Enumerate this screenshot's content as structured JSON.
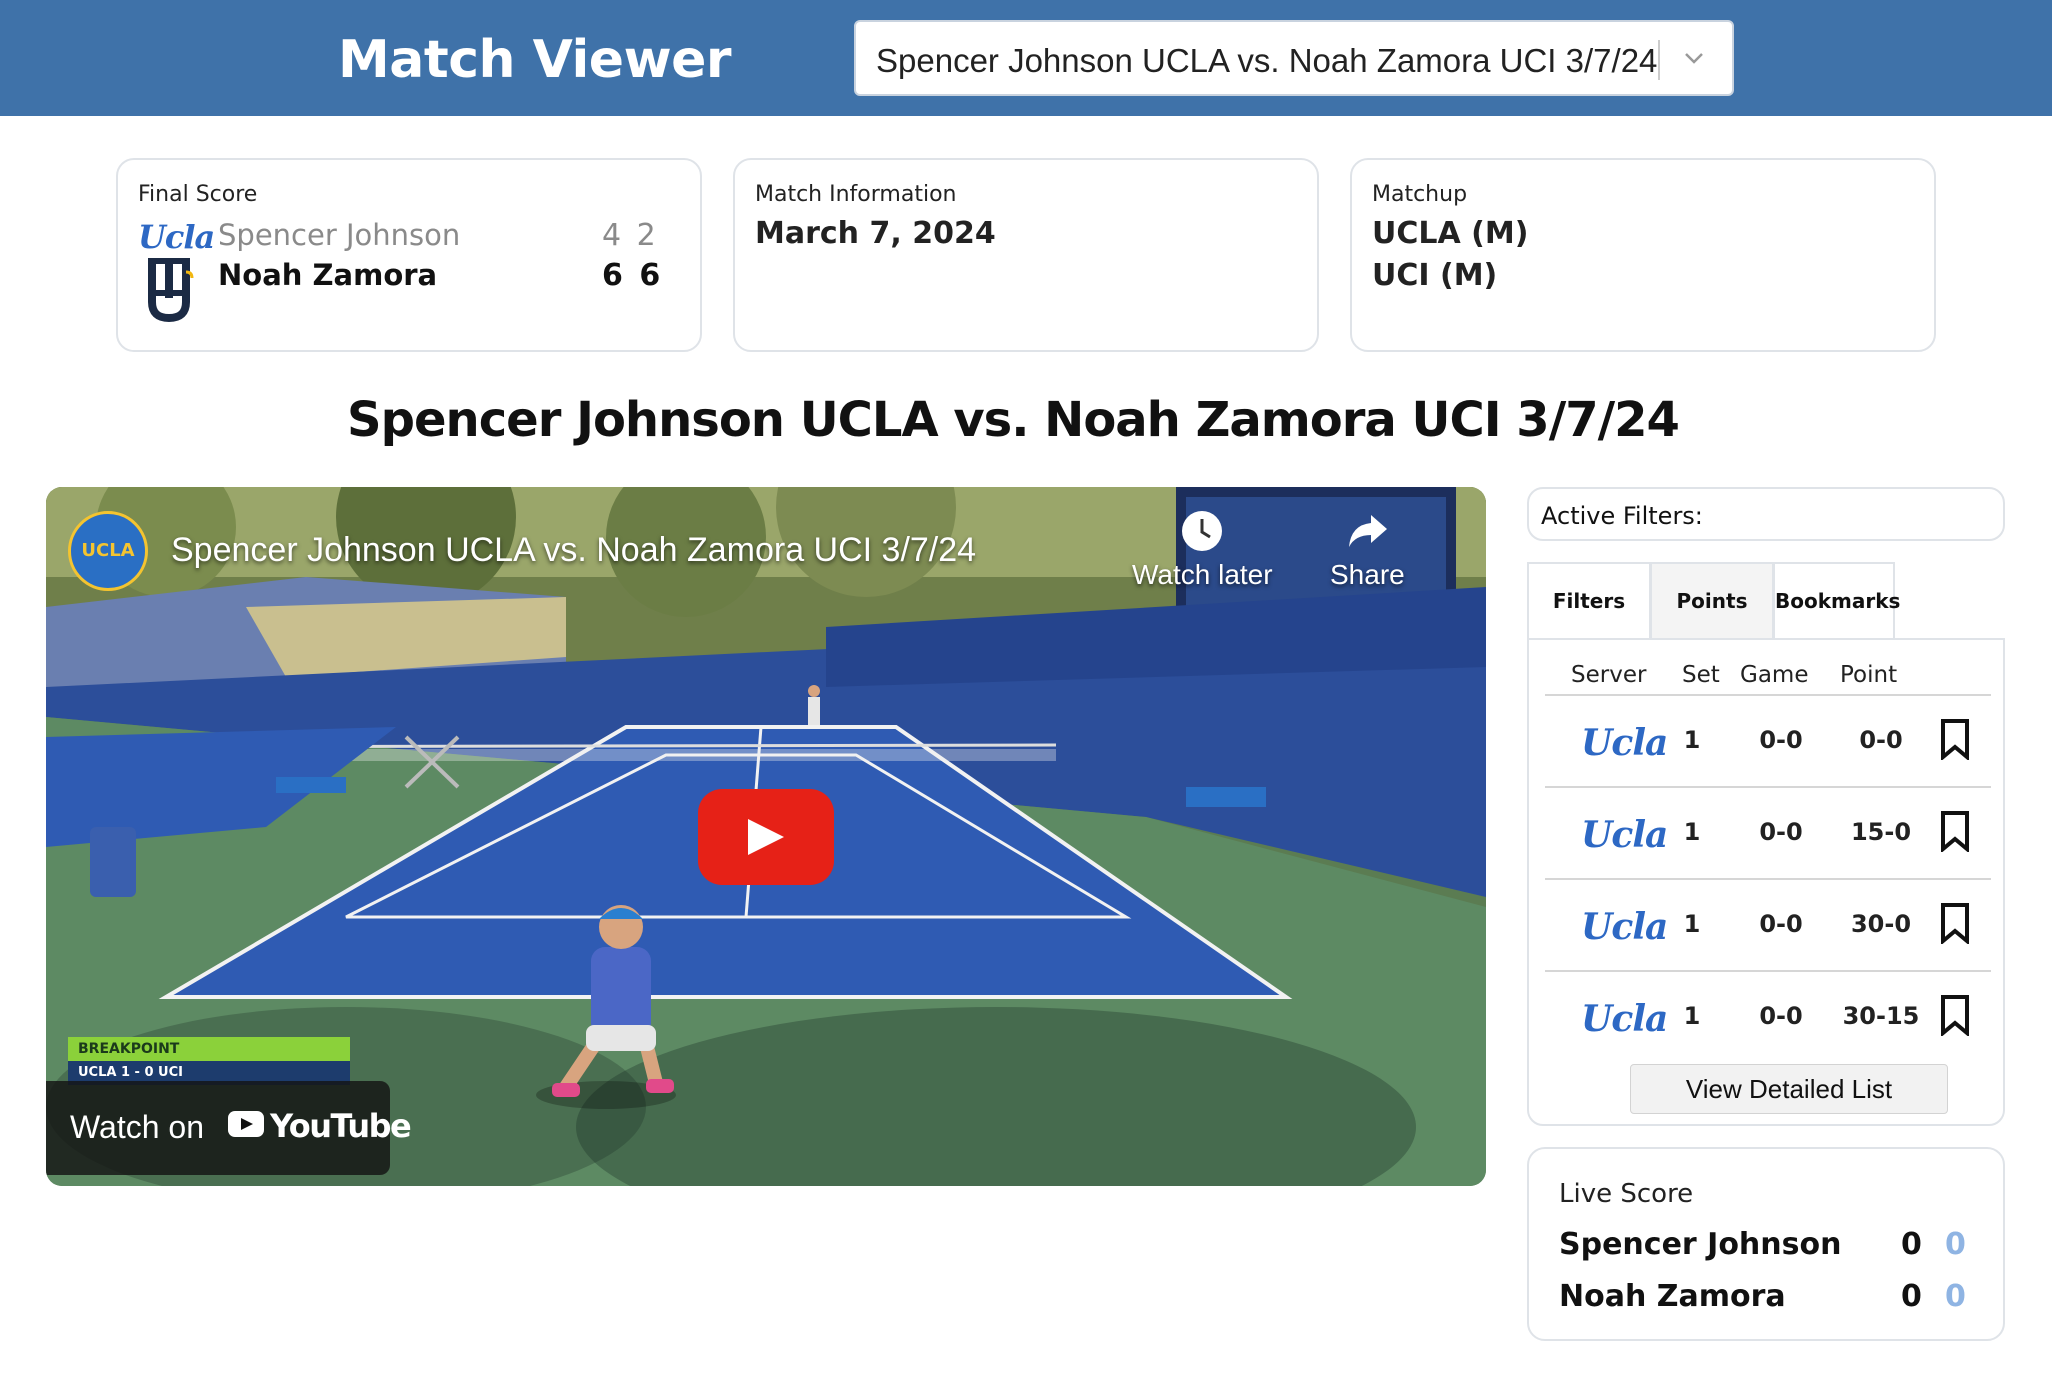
{
  "header": {
    "app_title": "Match Viewer",
    "match_select_value": "Spencer Johnson UCLA vs. Noah Zamora UCI 3/7/24"
  },
  "final_score": {
    "label": "Final Score",
    "players": [
      {
        "name": "Spencer Johnson",
        "team_logo": "Ucla",
        "sets": "4 2",
        "winner": false
      },
      {
        "name": "Noah Zamora",
        "team_logo": "UCI-logo",
        "sets": "6 6",
        "winner": true
      }
    ]
  },
  "match_info": {
    "label": "Match Information",
    "date": "March 7, 2024"
  },
  "matchup": {
    "label": "Matchup",
    "team1": "UCLA (M)",
    "team2": "UCI (M)"
  },
  "match_heading": "Spencer Johnson UCLA vs. Noah Zamora UCI 3/7/24",
  "video": {
    "title": "Spencer Johnson UCLA vs. Noah Zamora UCI 3/7/24",
    "channel_logo_text": "UCLA",
    "watch_later": "Watch later",
    "share": "Share",
    "watch_on": "Watch on",
    "youtube": "YouTube",
    "scorebug_title": "BREAKPOINT",
    "scorebug_score": "UCLA 1 - 0 UCI"
  },
  "active_filters": {
    "label": "Active Filters:"
  },
  "tabs": [
    {
      "label": "Filters"
    },
    {
      "label": "Points"
    },
    {
      "label": "Bookmarks"
    }
  ],
  "points_table": {
    "headers": {
      "server": "Server",
      "set": "Set",
      "game": "Game",
      "point": "Point"
    },
    "rows": [
      {
        "server": "Ucla",
        "set": "1",
        "game": "0-0",
        "point": "0-0"
      },
      {
        "server": "Ucla",
        "set": "1",
        "game": "0-0",
        "point": "15-0"
      },
      {
        "server": "Ucla",
        "set": "1",
        "game": "0-0",
        "point": "30-0"
      },
      {
        "server": "Ucla",
        "set": "1",
        "game": "0-0",
        "point": "30-15"
      }
    ],
    "detail_button": "View Detailed List"
  },
  "live_score": {
    "label": "Live Score",
    "players": [
      {
        "name": "Spencer Johnson",
        "sets": "0",
        "games": "0"
      },
      {
        "name": "Noah Zamora",
        "sets": "0",
        "games": "0"
      }
    ]
  },
  "colors": {
    "header_bg": "#3f72a9",
    "ucla_blue": "#2d68c4",
    "youtube_red": "#e62117",
    "live_games": "#8fb4e3"
  }
}
